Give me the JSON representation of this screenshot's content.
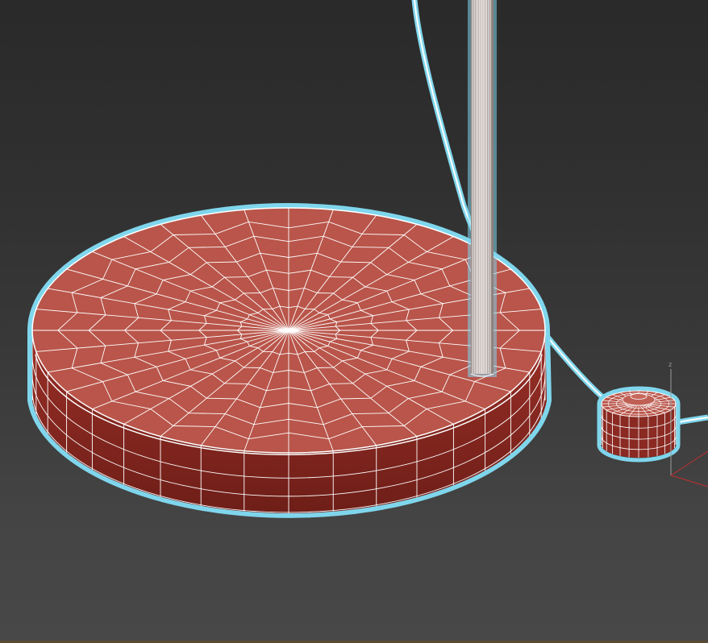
{
  "viewport": {
    "axis_gizmo": {
      "z_label": "z"
    }
  },
  "colors": {
    "background_top": "#2a2a2a",
    "background_bottom": "#484848",
    "mesh_fill_top": "#b9554a",
    "mesh_fill_side": "#8a2a22",
    "wireframe": "#ffffff",
    "selection_glow": "#7fd6ec",
    "axis_x": "#c03030",
    "axis_z": "#9a9a9a"
  },
  "icons": [
    "axis-gizmo-icon"
  ]
}
